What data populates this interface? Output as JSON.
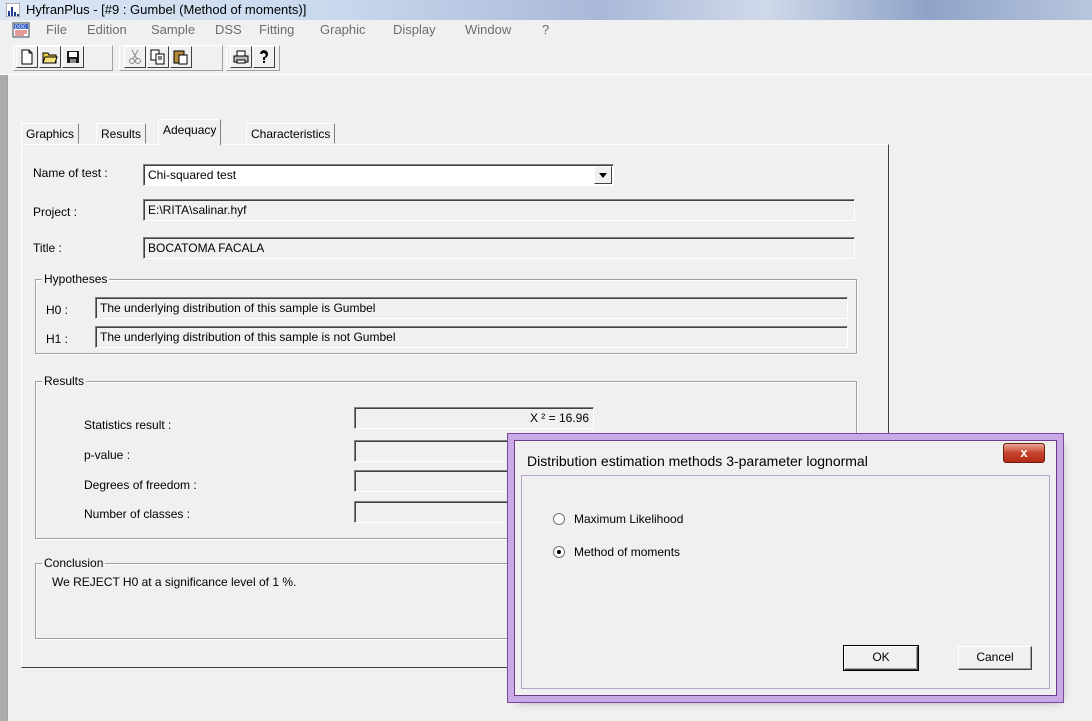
{
  "window": {
    "title": "HyfranPlus - [#9 : Gumbel (Method of moments)]"
  },
  "menu": [
    "File",
    "Edition",
    "Sample",
    "DSS",
    "Fitting",
    "Graphic",
    "Display",
    "Window",
    "?"
  ],
  "toolbar": {
    "buttons": [
      "new-icon",
      "open-icon",
      "save-icon",
      "cut-icon",
      "copy-icon",
      "paste-icon",
      "print-icon",
      "help-icon"
    ]
  },
  "tabs": [
    "Graphics",
    "Results",
    "Adequacy",
    "Characteristics"
  ],
  "adequacy": {
    "test_label": "Name of test :",
    "test_value": "Chi-squared test",
    "project_label": "Project :",
    "project_value": "E:\\RITA\\salinar.hyf",
    "title_label": "Title :",
    "title_value": "BOCATOMA FACALA",
    "hypotheses": {
      "legend": "Hypotheses",
      "h0_label": "H0 :",
      "h0_value": "The underlying distribution of this sample is  Gumbel",
      "h1_label": "H1 :",
      "h1_value": "The underlying distribution of this sample is not  Gumbel"
    },
    "results": {
      "legend": "Results",
      "statistics_label": "Statistics result :",
      "statistics_value": "X ² = 16.96",
      "pvalue_label": "p-value :",
      "dof_label": "Degrees of freedom :",
      "classes_label": "Number of classes :"
    },
    "conclusion": {
      "legend": "Conclusion",
      "text": "We REJECT H0 at a significance level of 1 %."
    }
  },
  "dialog": {
    "title": "Distribution estimation methods 3-parameter lognormal",
    "close": "x",
    "options": [
      "Maximum Likelihood",
      "Method of moments"
    ],
    "selected": "Method of moments",
    "ok": "OK",
    "cancel": "Cancel"
  },
  "colors": {
    "dialog_frame": "#c9a9e6",
    "close_button": "#c7432c"
  }
}
